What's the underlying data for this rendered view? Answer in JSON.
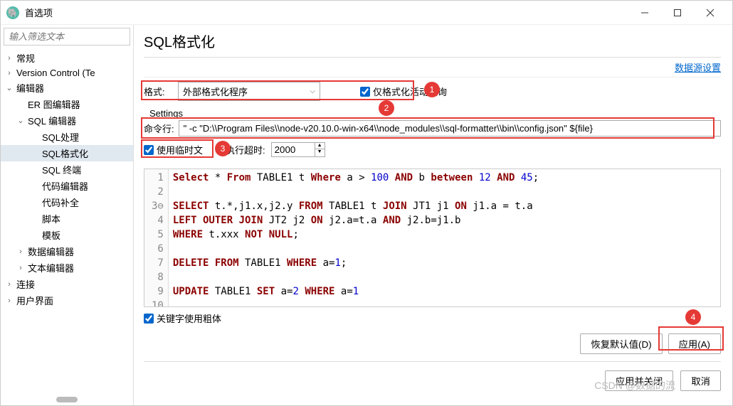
{
  "window": {
    "title": "首选项"
  },
  "sidebar": {
    "filter_placeholder": "输入筛选文本",
    "items": [
      {
        "label": "常规",
        "expanded": false,
        "indent": 0
      },
      {
        "label": "Version Control (Te",
        "expanded": false,
        "indent": 0
      },
      {
        "label": "编辑器",
        "expanded": true,
        "indent": 0
      },
      {
        "label": "ER 图编辑器",
        "expanded": null,
        "indent": 1
      },
      {
        "label": "SQL 编辑器",
        "expanded": true,
        "indent": 1
      },
      {
        "label": "SQL处理",
        "expanded": null,
        "indent": 2
      },
      {
        "label": "SQL格式化",
        "expanded": null,
        "indent": 2,
        "selected": true
      },
      {
        "label": "SQL 终端",
        "expanded": null,
        "indent": 2
      },
      {
        "label": "代码编辑器",
        "expanded": null,
        "indent": 2
      },
      {
        "label": "代码补全",
        "expanded": null,
        "indent": 2
      },
      {
        "label": "脚本",
        "expanded": null,
        "indent": 2
      },
      {
        "label": "模板",
        "expanded": null,
        "indent": 2
      },
      {
        "label": "数据编辑器",
        "expanded": false,
        "indent": 1
      },
      {
        "label": "文本编辑器",
        "expanded": false,
        "indent": 1
      },
      {
        "label": "连接",
        "expanded": false,
        "indent": 0
      },
      {
        "label": "用户界面",
        "expanded": false,
        "indent": 0
      }
    ]
  },
  "main": {
    "title": "SQL格式化",
    "datasource_link": "数据源设置",
    "format_label": "格式:",
    "format_value": "外部格式化程序",
    "only_active_label": "仅格式化活动查询",
    "only_active_checked": true,
    "settings_legend": "Settings",
    "cmdline_label": "命令行:",
    "cmdline_value": "\" -c \"D:\\\\Program Files\\\\node-v20.10.0-win-x64\\\\node_modules\\\\sql-formatter\\\\bin\\\\config.json\" ${file}",
    "use_temp_label": "使用临时文",
    "use_temp_checked": true,
    "timeout_label": "执行超时:",
    "timeout_value": "2000",
    "bold_kw_label": "关键字使用粗体",
    "bold_kw_checked": true,
    "restore_defaults_btn": "恢复默认值(D)",
    "apply_btn": "应用(A)",
    "apply_close_btn": "应用并关闭",
    "cancel_btn": "取消"
  },
  "code": {
    "lines": [
      "1",
      "2",
      "3",
      "4",
      "5",
      "6",
      "7",
      "8",
      "9",
      "10"
    ],
    "content": [
      [
        {
          "t": "Select",
          "c": "kw"
        },
        {
          "t": " * "
        },
        {
          "t": "From",
          "c": "kw"
        },
        {
          "t": " TABLE1 t "
        },
        {
          "t": "Where",
          "c": "kw"
        },
        {
          "t": " a > "
        },
        {
          "t": "100",
          "c": "num"
        },
        {
          "t": " "
        },
        {
          "t": "AND",
          "c": "kw"
        },
        {
          "t": " b "
        },
        {
          "t": "between",
          "c": "kw"
        },
        {
          "t": " "
        },
        {
          "t": "12",
          "c": "num"
        },
        {
          "t": " "
        },
        {
          "t": "AND",
          "c": "kw"
        },
        {
          "t": " "
        },
        {
          "t": "45",
          "c": "num"
        },
        {
          "t": ";"
        }
      ],
      [],
      [
        {
          "t": "SELECT",
          "c": "kw"
        },
        {
          "t": " t.*,j1.x,j2.y "
        },
        {
          "t": "FROM",
          "c": "kw"
        },
        {
          "t": " TABLE1 t "
        },
        {
          "t": "JOIN",
          "c": "kw"
        },
        {
          "t": " JT1 j1 "
        },
        {
          "t": "ON",
          "c": "kw"
        },
        {
          "t": " j1.a = t.a"
        }
      ],
      [
        {
          "t": "LEFT OUTER JOIN",
          "c": "kw"
        },
        {
          "t": " JT2 j2 "
        },
        {
          "t": "ON",
          "c": "kw"
        },
        {
          "t": " j2.a=t.a "
        },
        {
          "t": "AND",
          "c": "kw"
        },
        {
          "t": " j2.b=j1.b"
        }
      ],
      [
        {
          "t": "WHERE",
          "c": "kw"
        },
        {
          "t": " t.xxx "
        },
        {
          "t": "NOT NULL",
          "c": "kw"
        },
        {
          "t": ";"
        }
      ],
      [],
      [
        {
          "t": "DELETE FROM",
          "c": "kw"
        },
        {
          "t": " TABLE1 "
        },
        {
          "t": "WHERE",
          "c": "kw"
        },
        {
          "t": " a="
        },
        {
          "t": "1",
          "c": "num"
        },
        {
          "t": ";"
        }
      ],
      [],
      [
        {
          "t": "UPDATE",
          "c": "kw"
        },
        {
          "t": " TABLE1 "
        },
        {
          "t": "SET",
          "c": "kw"
        },
        {
          "t": " a="
        },
        {
          "t": "2",
          "c": "num"
        },
        {
          "t": " "
        },
        {
          "t": "WHERE",
          "c": "kw"
        },
        {
          "t": " a="
        },
        {
          "t": "1",
          "c": "num"
        }
      ],
      []
    ]
  },
  "badges": {
    "b1": "1",
    "b2": "2",
    "b3": "3",
    "b4": "4"
  },
  "watermark": "CSDN @数据的流"
}
